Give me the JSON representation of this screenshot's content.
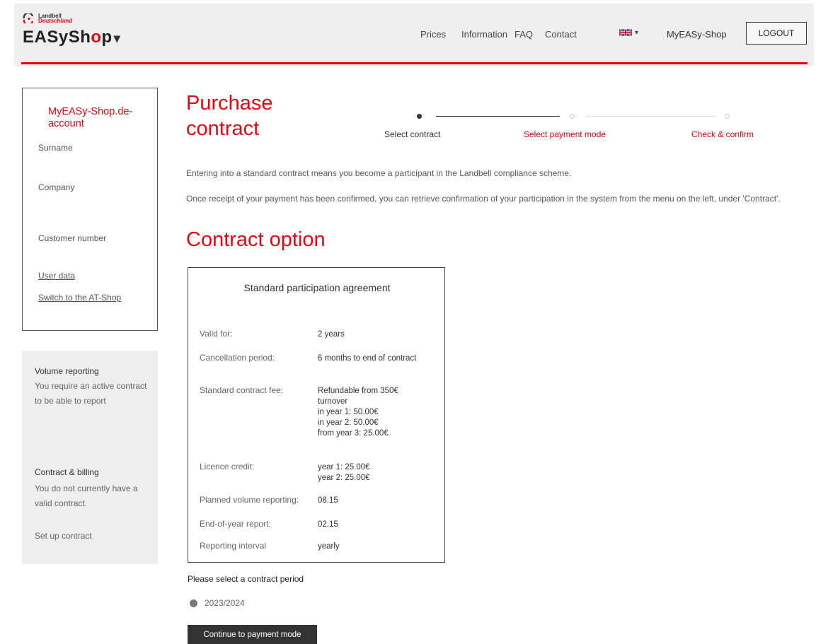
{
  "header": {
    "logo": {
      "line1": "Landbell",
      "line2": "Deutschland",
      "wordmark_pre": "EASySh",
      "wordmark_o": "o",
      "wordmark_post": "p",
      "caret": "▾"
    },
    "nav": {
      "prices": "Prices",
      "information": "Information",
      "faq": "FAQ",
      "contact": "Contact"
    },
    "language": {
      "icon": "uk-flag-icon",
      "caret": "▾"
    },
    "account_link": "MyEASy-Shop",
    "logout_label": "LOGOUT"
  },
  "account": {
    "title": "MyEASy-Shop.de-account",
    "surname_label": "Surname",
    "company_label": "Company",
    "customer_number_label": "Customer number",
    "user_data_link": "User data",
    "switch_shop_link": "Switch to the AT-Shop"
  },
  "side": {
    "volume_heading": "Volume reporting",
    "volume_text": "You require an active contract to be able to report",
    "billing_heading": "Contract & billing",
    "billing_text": "You do not currently have a valid contract.",
    "setup_link": "Set up contract"
  },
  "main": {
    "title": "Purchase contract",
    "steps": [
      {
        "label": "Select contract",
        "state": "active"
      },
      {
        "label": "Select payment mode",
        "state": "upcoming"
      },
      {
        "label": "Check & confirm",
        "state": "upcoming"
      }
    ],
    "intro1": "Entering into a standard contract means you become a participant in the Landbell compliance scheme.",
    "intro2": "Once receipt of your payment has been confirmed, you can retrieve confirmation of your participation in the system from the menu on the left, under 'Contract'.",
    "section_title": "Contract option",
    "card": {
      "title": "Standard participation agreement",
      "rows": [
        {
          "label": "Valid for:",
          "value": "2 years"
        },
        {
          "label": "Cancellation period:",
          "value": "6 months to end of contract"
        },
        {
          "label": "Standard contract fee:",
          "value": "Refundable from 350€ turnover\nin year 1: 50.00€\nin year 2: 50.00€\nfrom year 3: 25.00€"
        },
        {
          "label": "Licence credit:",
          "value": "year 1: 25.00€\nyear 2: 25.00€"
        },
        {
          "label": "Planned volume reporting:",
          "value": "08.15"
        },
        {
          "label": "End-of-year report:",
          "value": "02.15"
        },
        {
          "label": "Reporting interval",
          "value": "yearly"
        }
      ]
    },
    "period_prompt": "Please select a contract period",
    "period_option": "2023/2024",
    "continue_label": "Continue to payment mode"
  },
  "colors": {
    "accent": "#e30613",
    "text": "#555555",
    "button": "#333333",
    "panel": "#eeeeee"
  }
}
